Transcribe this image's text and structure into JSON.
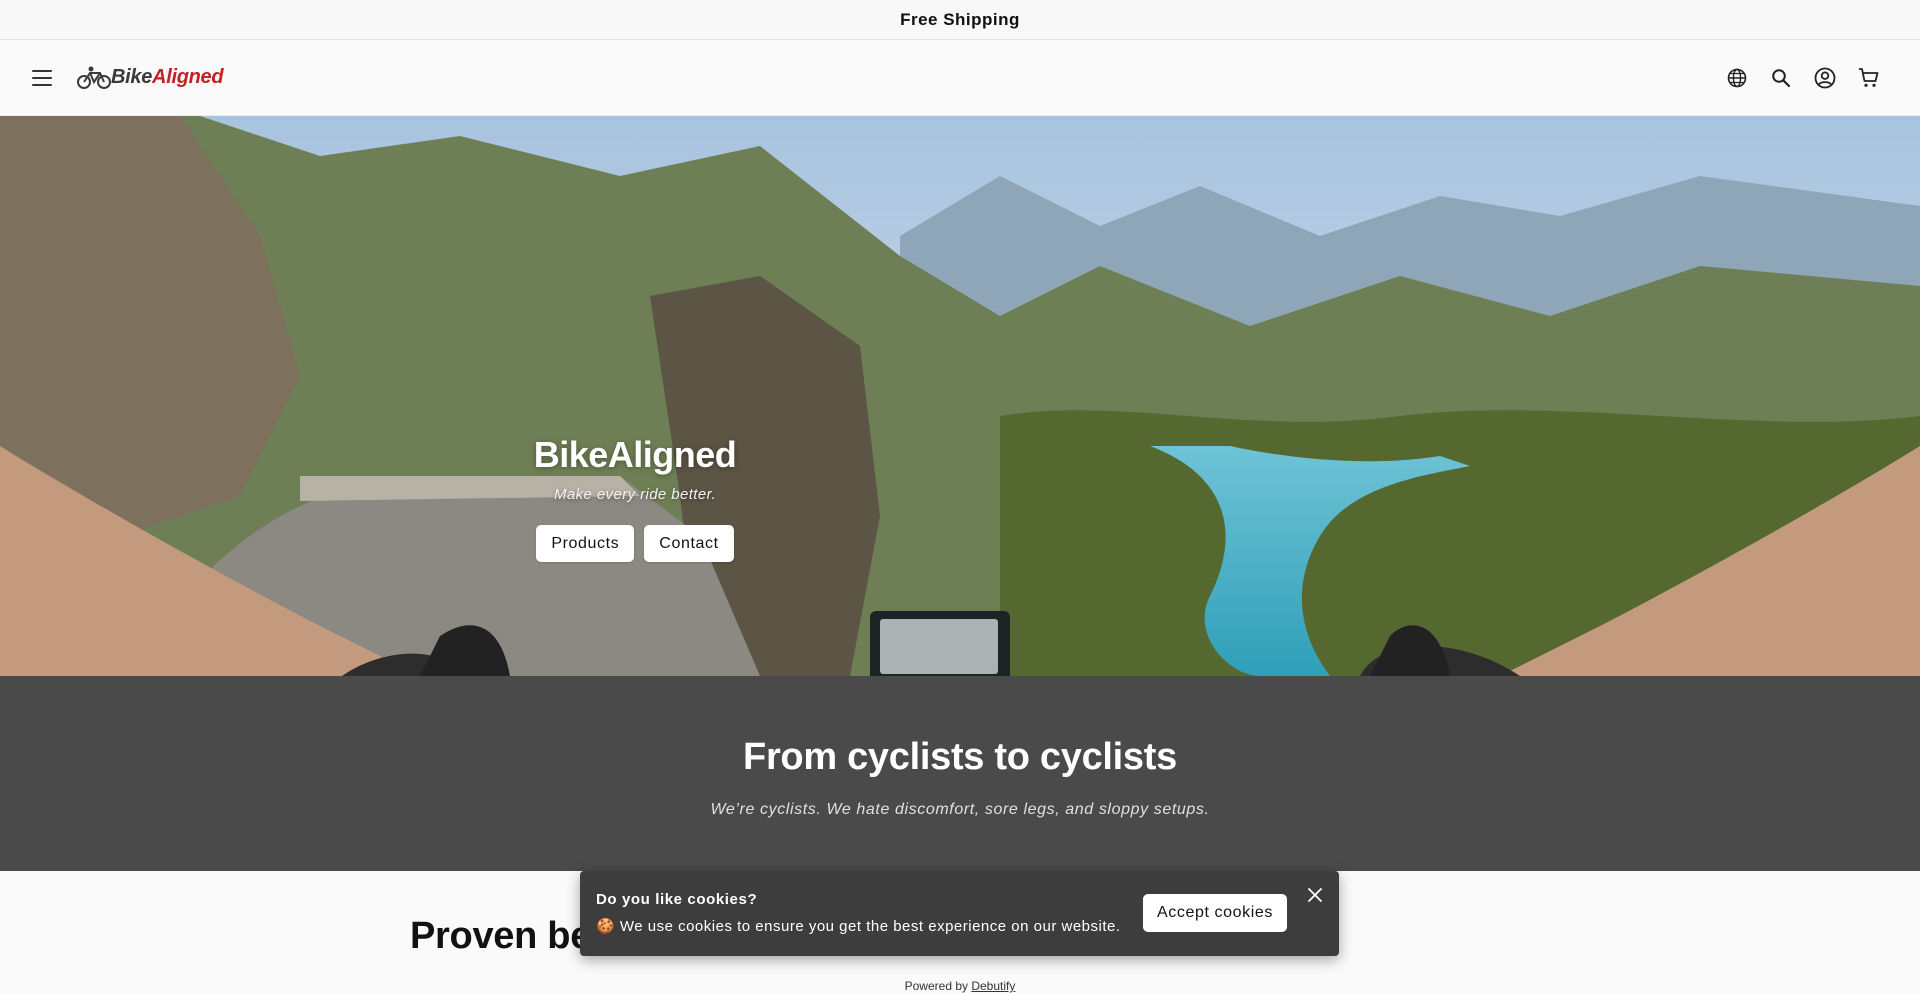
{
  "announcement": {
    "text": "Free Shipping"
  },
  "header": {
    "logo_prefix": "Bike",
    "logo_suffix": "Aligned",
    "icons": [
      "menu-icon",
      "globe-icon",
      "search-icon",
      "account-icon",
      "cart-icon"
    ]
  },
  "hero": {
    "title": "BikeAligned",
    "subtitle": "Make every ride better.",
    "buttons": [
      "Products",
      "Contact"
    ]
  },
  "intro": {
    "title": "From cyclists to cyclists",
    "text": "We’re cyclists. We hate discomfort, sore legs, and sloppy setups."
  },
  "featured": {
    "title_partial": "Proven be"
  },
  "cookie_banner": {
    "title": "Do you like cookies?",
    "text": "🍪 We use cookies to ensure you get the best experience on our website.",
    "accept_label": "Accept cookies"
  },
  "powered_by": {
    "prefix": "Powered by",
    "brand": "Debutify"
  },
  "colors": {
    "brand_red": "#c42126",
    "dark_section": "#4a4a4a",
    "cookie_bg": "#3d3d3d"
  }
}
